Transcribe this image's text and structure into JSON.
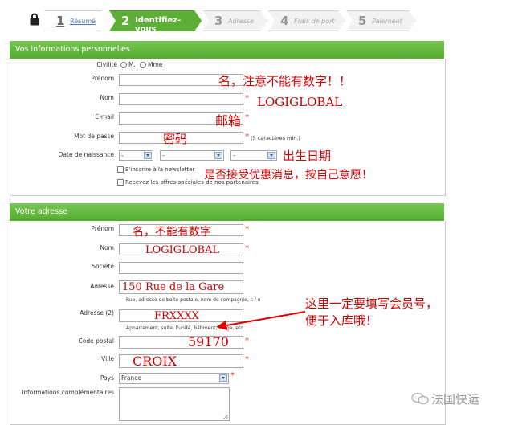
{
  "steps": [
    {
      "num": "1",
      "label": "Résumé"
    },
    {
      "num": "2",
      "label": "Identifiez-vous"
    },
    {
      "num": "3",
      "label": "Adresse"
    },
    {
      "num": "4",
      "label": "Frais de port"
    },
    {
      "num": "5",
      "label": "Paiement"
    }
  ],
  "personal": {
    "title": "Vos informations personnelles",
    "civilite_label": "Civilité",
    "opt_m": "M.",
    "opt_mme": "Mme",
    "prenom_label": "Prénom",
    "nom_label": "Nom",
    "email_label": "E-mail",
    "password_label": "Mot de passe",
    "password_hint": "(5 caractères min.)",
    "birth_label": "Date de naissance",
    "birth_day": "-",
    "birth_month": "-",
    "birth_year": "-",
    "newsletter_label": "S'inscrire à la newsletter",
    "offers_label": "Recevez les offres spéciales de nos partenaires"
  },
  "address": {
    "title": "Votre adresse",
    "prenom_label": "Prénom",
    "nom_label": "Nom",
    "nom_value": "LOGIGLOBAL",
    "societe_label": "Société",
    "adresse_label": "Adresse",
    "adresse_value": "150 Rue de la Gare",
    "adresse_hint": "Rue, adresse de boite postale, nom de compagnie, c / o",
    "adresse2_label": "Adresse (2)",
    "adresse2_value": "FRXXXX",
    "adresse2_hint": "Appartement, suite, l'unité, bâtiment, étage, etc",
    "cp_label": "Code postal",
    "cp_value": "59170",
    "ville_label": "Ville",
    "ville_value": "CROIX",
    "pays_label": "Pays",
    "pays_value": "France",
    "info_label": "Informations complémentaires"
  },
  "annotations": {
    "prenom_note": "名，注意不能有数字！！",
    "nom_note": "LOGIGLOBAL",
    "email_note": "邮箱",
    "password_note": "密码",
    "birth_note": "出生日期",
    "newsletter_note": "是否接受优惠消息，按自己意愿！",
    "addr_prenom_note": "名，不能有数字",
    "addr2_note_line1": "这里一定要填写会员号，",
    "addr2_note_line2": "便于入库哦！",
    "arrow_color": "#e00000"
  },
  "watermark": "法国快运",
  "colors": {
    "accent": "#5cae34",
    "annotation": "#d10000"
  }
}
